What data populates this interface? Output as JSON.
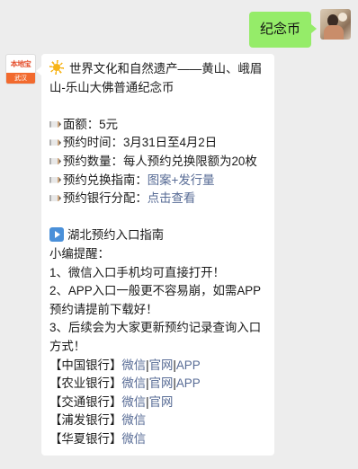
{
  "outgoing": {
    "text": "纪念币"
  },
  "account": {
    "logo_top": "本地宝",
    "logo_bottom": "武汉"
  },
  "message": {
    "title": "世界文化和自然遗产——黄山、峨眉山-乐山大佛普通纪念币",
    "face_value": "面额：5元",
    "reserve_time": "预约时间：3月31日至4月2日",
    "reserve_qty": "预约数量：每人预约兑换限额为20枚",
    "guide_label": "预约兑换指南：",
    "guide_link": "图案+发行量",
    "bank_label": "预约银行分配：",
    "bank_link": "点击查看",
    "hubei_title": "湖北预约入口指南",
    "tip_title": "小编提醒：",
    "tip1": "1、微信入口手机均可直接打开！",
    "tip2": "2、APP入口一般更不容易崩，如需APP预约请提前下载好！",
    "tip3": "3、后续会为大家更新预约记录查询入口方式！",
    "sep": "|",
    "banks": [
      {
        "name": "【中国银行】",
        "links": [
          "微信",
          "官网",
          "APP"
        ]
      },
      {
        "name": "【农业银行】",
        "links": [
          "微信",
          "官网",
          "APP"
        ]
      },
      {
        "name": "【交通银行】",
        "links": [
          "微信",
          "官网"
        ]
      },
      {
        "name": "【浦发银行】",
        "links": [
          "微信"
        ]
      },
      {
        "name": "【华夏银行】",
        "links": [
          "微信"
        ]
      }
    ]
  },
  "colors": {
    "outgoing_bubble": "#95ec69",
    "link": "#576b95",
    "background": "#ededed"
  }
}
